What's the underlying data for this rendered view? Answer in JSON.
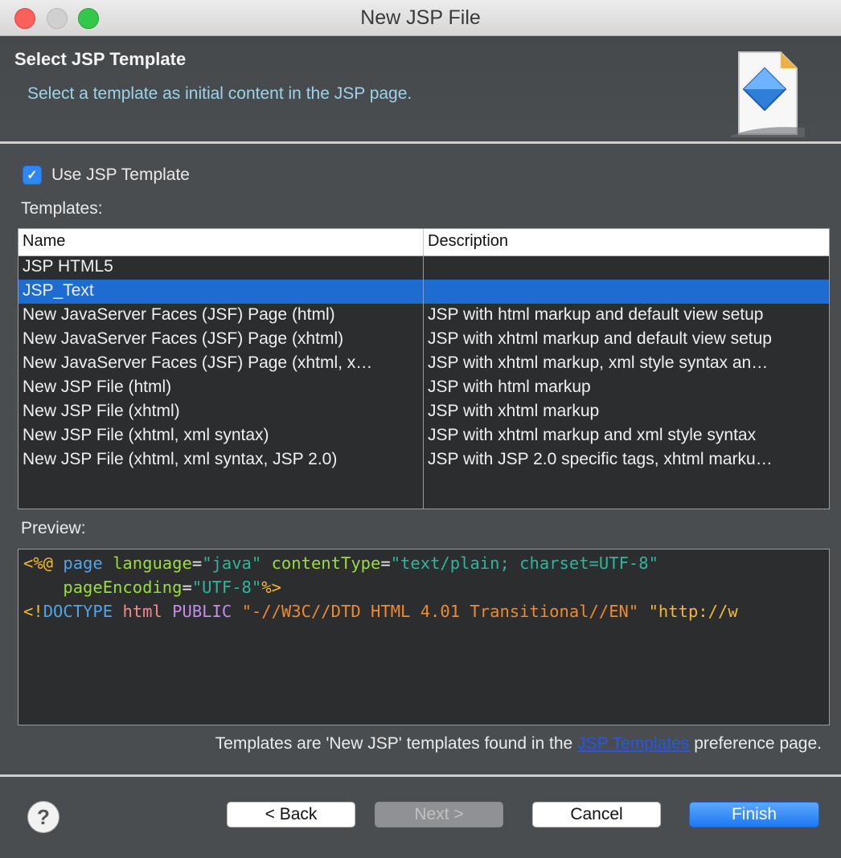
{
  "window": {
    "title": "New JSP File"
  },
  "header": {
    "title": "Select JSP Template",
    "description": "Select a template as initial content in the JSP page."
  },
  "use_template": {
    "label": "Use JSP Template",
    "checked": true
  },
  "templates": {
    "label": "Templates:",
    "columns": {
      "name": "Name",
      "description": "Description"
    },
    "rows": [
      {
        "name": "JSP HTML5",
        "description": ""
      },
      {
        "name": "JSP_Text",
        "description": "",
        "selected": true
      },
      {
        "name": "New JavaServer Faces (JSF) Page (html)",
        "description": "JSP with html markup and default view setup"
      },
      {
        "name": "New JavaServer Faces (JSF) Page (xhtml)",
        "description": "JSP with xhtml markup and default view setup"
      },
      {
        "name": "New JavaServer Faces (JSF) Page (xhtml, x…",
        "description": "JSP with xhtml markup, xml style syntax an…"
      },
      {
        "name": "New JSP File (html)",
        "description": "JSP with html markup"
      },
      {
        "name": "New JSP File (xhtml)",
        "description": "JSP with xhtml markup"
      },
      {
        "name": "New JSP File (xhtml, xml syntax)",
        "description": "JSP with xhtml markup and xml style syntax"
      },
      {
        "name": "New JSP File (xhtml, xml syntax, JSP 2.0)",
        "description": "JSP with JSP 2.0 specific tags, xhtml marku…"
      }
    ]
  },
  "preview": {
    "label": "Preview:",
    "lines": [
      [
        [
          "<%@",
          "y"
        ],
        [
          " ",
          "w"
        ],
        [
          "page",
          "b"
        ],
        [
          " ",
          "w"
        ],
        [
          "language",
          "g"
        ],
        [
          "=",
          "w"
        ],
        [
          "\"java\"",
          "t"
        ],
        [
          " ",
          "w"
        ],
        [
          "contentType",
          "g"
        ],
        [
          "=",
          "w"
        ],
        [
          "\"text/plain; charset=UTF-8\"",
          "t"
        ]
      ],
      [
        [
          "    ",
          "w"
        ],
        [
          "pageEncoding",
          "g"
        ],
        [
          "=",
          "w"
        ],
        [
          "\"UTF-8\"",
          "t"
        ],
        [
          "%>",
          "y"
        ]
      ],
      [
        [
          "<!",
          "y"
        ],
        [
          "DOCTYPE",
          "b"
        ],
        [
          " ",
          "w"
        ],
        [
          "html",
          "k"
        ],
        [
          " ",
          "w"
        ],
        [
          "PUBLIC",
          "p"
        ],
        [
          " ",
          "w"
        ],
        [
          "\"-//W3C//DTD HTML 4.01 Transitional//EN\"",
          "o"
        ],
        [
          " ",
          "w"
        ],
        [
          "\"http://w",
          "y"
        ]
      ]
    ]
  },
  "footnote": {
    "before": "Templates are 'New JSP' templates found in the ",
    "link": "JSP Templates",
    "after": " preference page."
  },
  "buttons": {
    "help": "?",
    "back": "< Back",
    "next": "Next >",
    "cancel": "Cancel",
    "finish": "Finish"
  }
}
